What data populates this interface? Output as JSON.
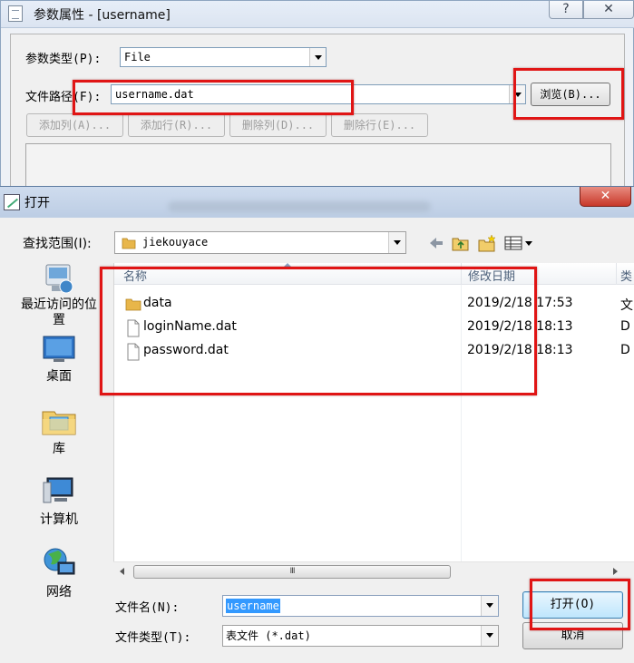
{
  "param_dialog": {
    "title": "参数属性 - [username]",
    "help_glyph": "?",
    "close_glyph": "✕",
    "param_type_label": "参数类型(P):",
    "param_type_value": "File",
    "file_path_label": "文件路径(F):",
    "file_path_value": "username.dat",
    "browse_button": "浏览(B)...",
    "buttons": [
      "添加列(A)...",
      "添加行(R)...",
      "删除列(D)...",
      "删除行(E)..."
    ]
  },
  "open_dialog": {
    "title": "打开",
    "close_glyph": "✕",
    "look_in_label": "查找范围(I):",
    "look_in_value": "jiekouyace",
    "places": [
      {
        "label": "最近访问的位置"
      },
      {
        "label": "桌面"
      },
      {
        "label": "库"
      },
      {
        "label": "计算机"
      },
      {
        "label": "网络"
      }
    ],
    "columns": {
      "name": "名称",
      "modified": "修改日期",
      "extra": "类"
    },
    "files": [
      {
        "name": "data",
        "date": "2019/2/18 17:53",
        "extra": "文",
        "type": "folder"
      },
      {
        "name": "loginName.dat",
        "date": "2019/2/18 18:13",
        "extra": "D",
        "type": "file"
      },
      {
        "name": "password.dat",
        "date": "2019/2/18 18:13",
        "extra": "D",
        "type": "file"
      }
    ],
    "scroll_thumb_grip": "III",
    "filename_label": "文件名(N):",
    "filename_value": "username",
    "filetype_label": "文件类型(T):",
    "filetype_value": "表文件 (*.dat)",
    "open_button": "打开(O)",
    "cancel_button": "取消"
  },
  "colors": {
    "annotation": "#e01515",
    "selection": "#3399ff",
    "folder": "#e8b64a"
  }
}
